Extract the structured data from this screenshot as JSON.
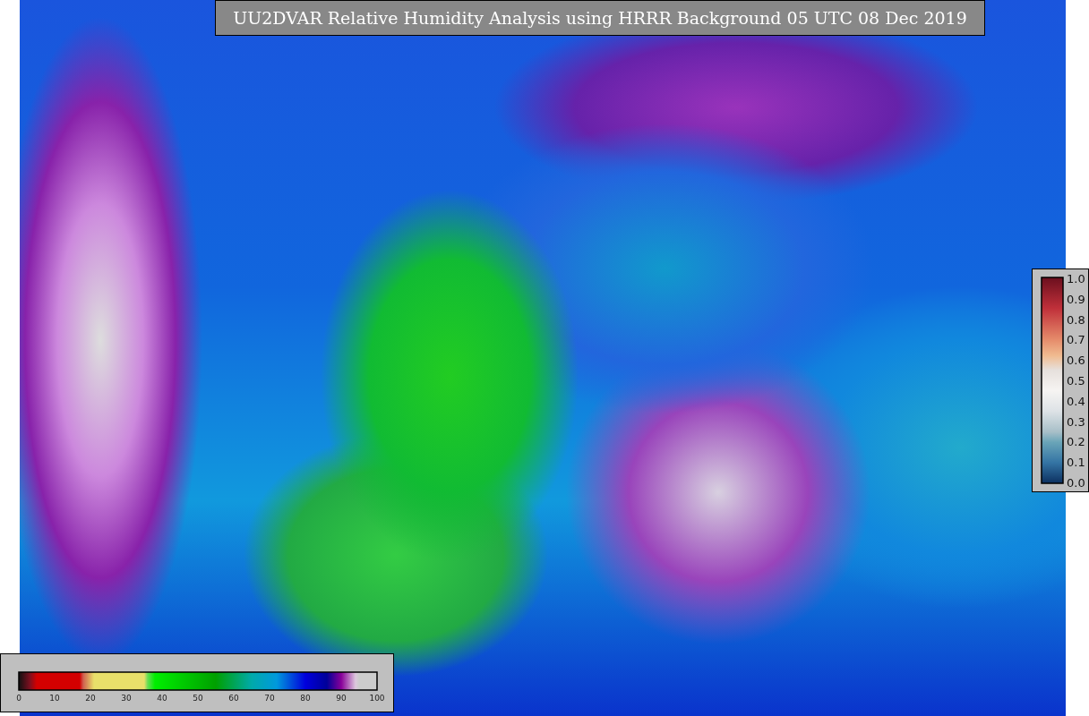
{
  "title": "UU2DVAR Relative Humidity Analysis using HRRR Background 05 UTC 08 Dec 2019",
  "humidity_colorbar": {
    "ticks": [
      "0",
      "10",
      "20",
      "30",
      "40",
      "50",
      "60",
      "70",
      "80",
      "90",
      "100"
    ]
  },
  "observation_colorbar": {
    "ticks": [
      "1.0",
      "0.9",
      "0.8",
      "0.7",
      "0.6",
      "0.5",
      "0.4",
      "0.3",
      "0.2",
      "0.1",
      "0.0"
    ]
  }
}
